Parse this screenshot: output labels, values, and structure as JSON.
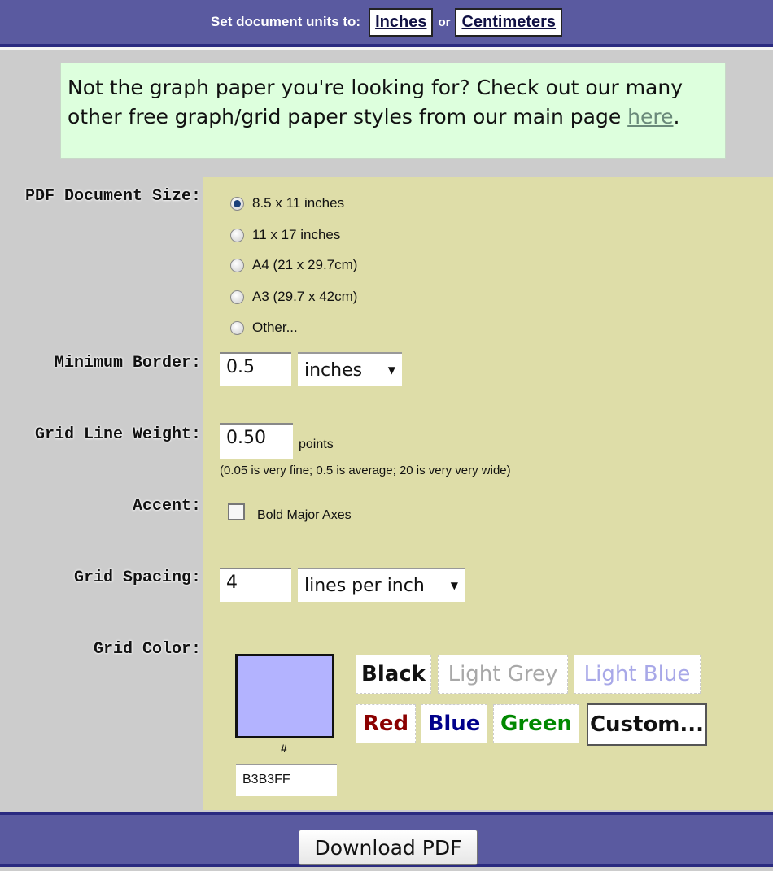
{
  "header": {
    "units_label": "Set document units to:",
    "inches_button": "Inches",
    "or_text": "or",
    "centimeters_button": "Centimeters"
  },
  "notice": {
    "text": "Not the graph paper you're looking for? Check out our many other free graph/grid paper styles from our main page ",
    "link_text": "here",
    "suffix": "."
  },
  "form": {
    "document_size": {
      "label": "PDF Document Size:",
      "options": [
        {
          "label": "8.5 x 11 inches",
          "selected": true
        },
        {
          "label": "11 x 17 inches",
          "selected": false
        },
        {
          "label": "A4 (21 x 29.7cm)",
          "selected": false
        },
        {
          "label": "A3 (29.7 x 42cm)",
          "selected": false
        },
        {
          "label": "Other...",
          "selected": false
        }
      ]
    },
    "minimum_border": {
      "label": "Minimum Border:",
      "value": "0.5",
      "unit_selected": "inches"
    },
    "grid_line_weight": {
      "label": "Grid Line Weight:",
      "value": "0.50",
      "unit": "points",
      "hint": "(0.05 is very fine; 0.5 is average; 20 is very very wide)"
    },
    "accent": {
      "label": "Accent:",
      "checkbox_label": "Bold Major Axes",
      "checked": false
    },
    "grid_spacing": {
      "label": "Grid Spacing:",
      "value": "4",
      "unit_selected": "lines per inch"
    },
    "grid_color": {
      "label": "Grid Color:",
      "hash": "#",
      "hex_value": "B3B3FF",
      "swatch_color": "#b3b3ff",
      "buttons": [
        {
          "label": "Black",
          "color": "#111111"
        },
        {
          "label": "Light Grey",
          "color": "#a8a8a8"
        },
        {
          "label": "Light Blue",
          "color": "#a8a8e8"
        },
        {
          "label": "Red",
          "color": "#8b0000"
        },
        {
          "label": "Blue",
          "color": "#00008b"
        },
        {
          "label": "Green",
          "color": "#008800"
        },
        {
          "label": "Custom...",
          "color": "#111111"
        }
      ]
    }
  },
  "footer": {
    "download_button": "Download PDF"
  }
}
